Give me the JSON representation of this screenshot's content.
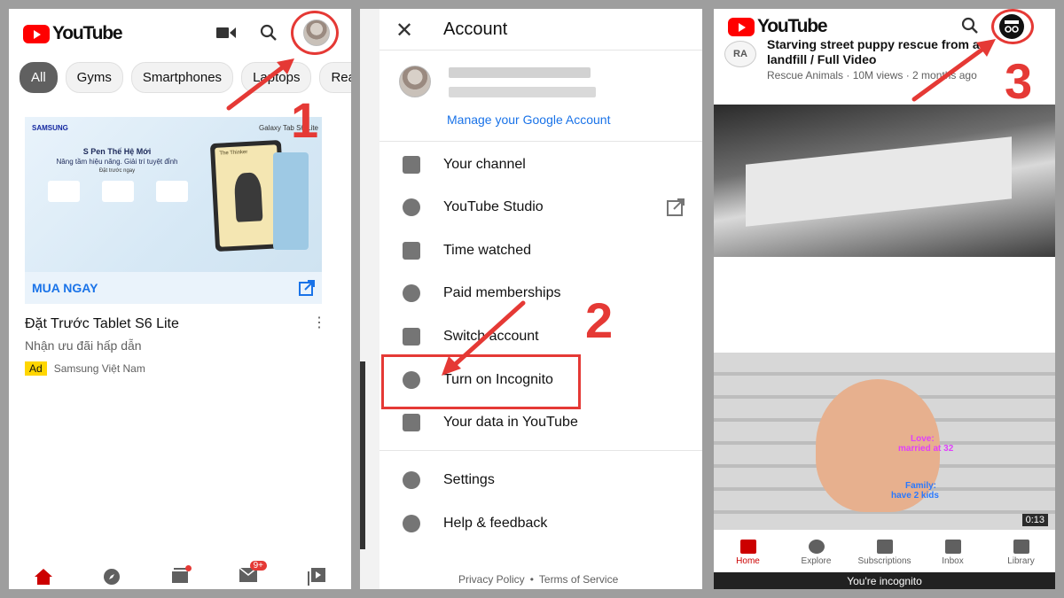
{
  "panel1": {
    "logo_text": "YouTube",
    "icons": [
      "camera-icon",
      "search-icon",
      "avatar-icon"
    ],
    "chips": [
      "All",
      "Gyms",
      "Smartphones",
      "Laptops",
      "Rea"
    ],
    "ad_banner_brand": "SAMSUNG",
    "ad_banner_model": "Galaxy Tab S6 Lite",
    "ad_banner_headline": "S Pen Thế Hệ Mới",
    "ad_banner_tagline": "Nâng tầm hiệu năng. Giải trí tuyệt đỉnh",
    "ad_banner_cta": "Đặt trước ngay",
    "ad_banner_screen_text": "The Thinker",
    "ad_cta": "MUA NGAY",
    "ad_title": "Đặt Trước Tablet S6 Lite",
    "ad_subtitle": "Nhận ưu đãi hấp dẫn",
    "ad_badge": "Ad",
    "ad_advertiser": "Samsung Việt Nam",
    "notification_badge": "9+",
    "step": "1"
  },
  "panel2": {
    "header_title": "Account",
    "manage_link": "Manage your Google Account",
    "menu": [
      {
        "label": "Your channel",
        "icon": "person-box-icon"
      },
      {
        "label": "YouTube Studio",
        "icon": "gear-icon"
      },
      {
        "label": "Time watched",
        "icon": "bar-chart-icon"
      },
      {
        "label": "Paid memberships",
        "icon": "dollar-icon"
      },
      {
        "label": "Switch account",
        "icon": "switch-account-icon"
      },
      {
        "label": "Turn on Incognito",
        "icon": "incognito-icon"
      },
      {
        "label": "Your data in YouTube",
        "icon": "shield-person-icon"
      },
      {
        "label": "Settings",
        "icon": "gear-icon"
      },
      {
        "label": "Help & feedback",
        "icon": "help-icon"
      }
    ],
    "footer_privacy": "Privacy Policy",
    "footer_sep": "•",
    "footer_terms": "Terms of Service",
    "step": "2"
  },
  "panel3": {
    "logo_text": "YouTube",
    "channel_initials": "RA",
    "video1_title_line1": "Starving street puppy rescue from a",
    "video1_title_line2": "landfill / Full Video",
    "video1_meta": "Rescue Animals · 10M views · 2 months ago",
    "video2_overlay1": "Love:",
    "video2_overlay2": "married at 32",
    "video2_overlay3": "Family:",
    "video2_overlay4": "have 2 kids",
    "video2_duration": "0:13",
    "tabs": [
      "Home",
      "Explore",
      "Subscriptions",
      "Inbox",
      "Library"
    ],
    "incognito_bar": "You're incognito",
    "step": "3"
  },
  "colors": {
    "accent_red": "#e53935",
    "youtube_red": "#ff0000",
    "link_blue": "#1a73e8"
  }
}
